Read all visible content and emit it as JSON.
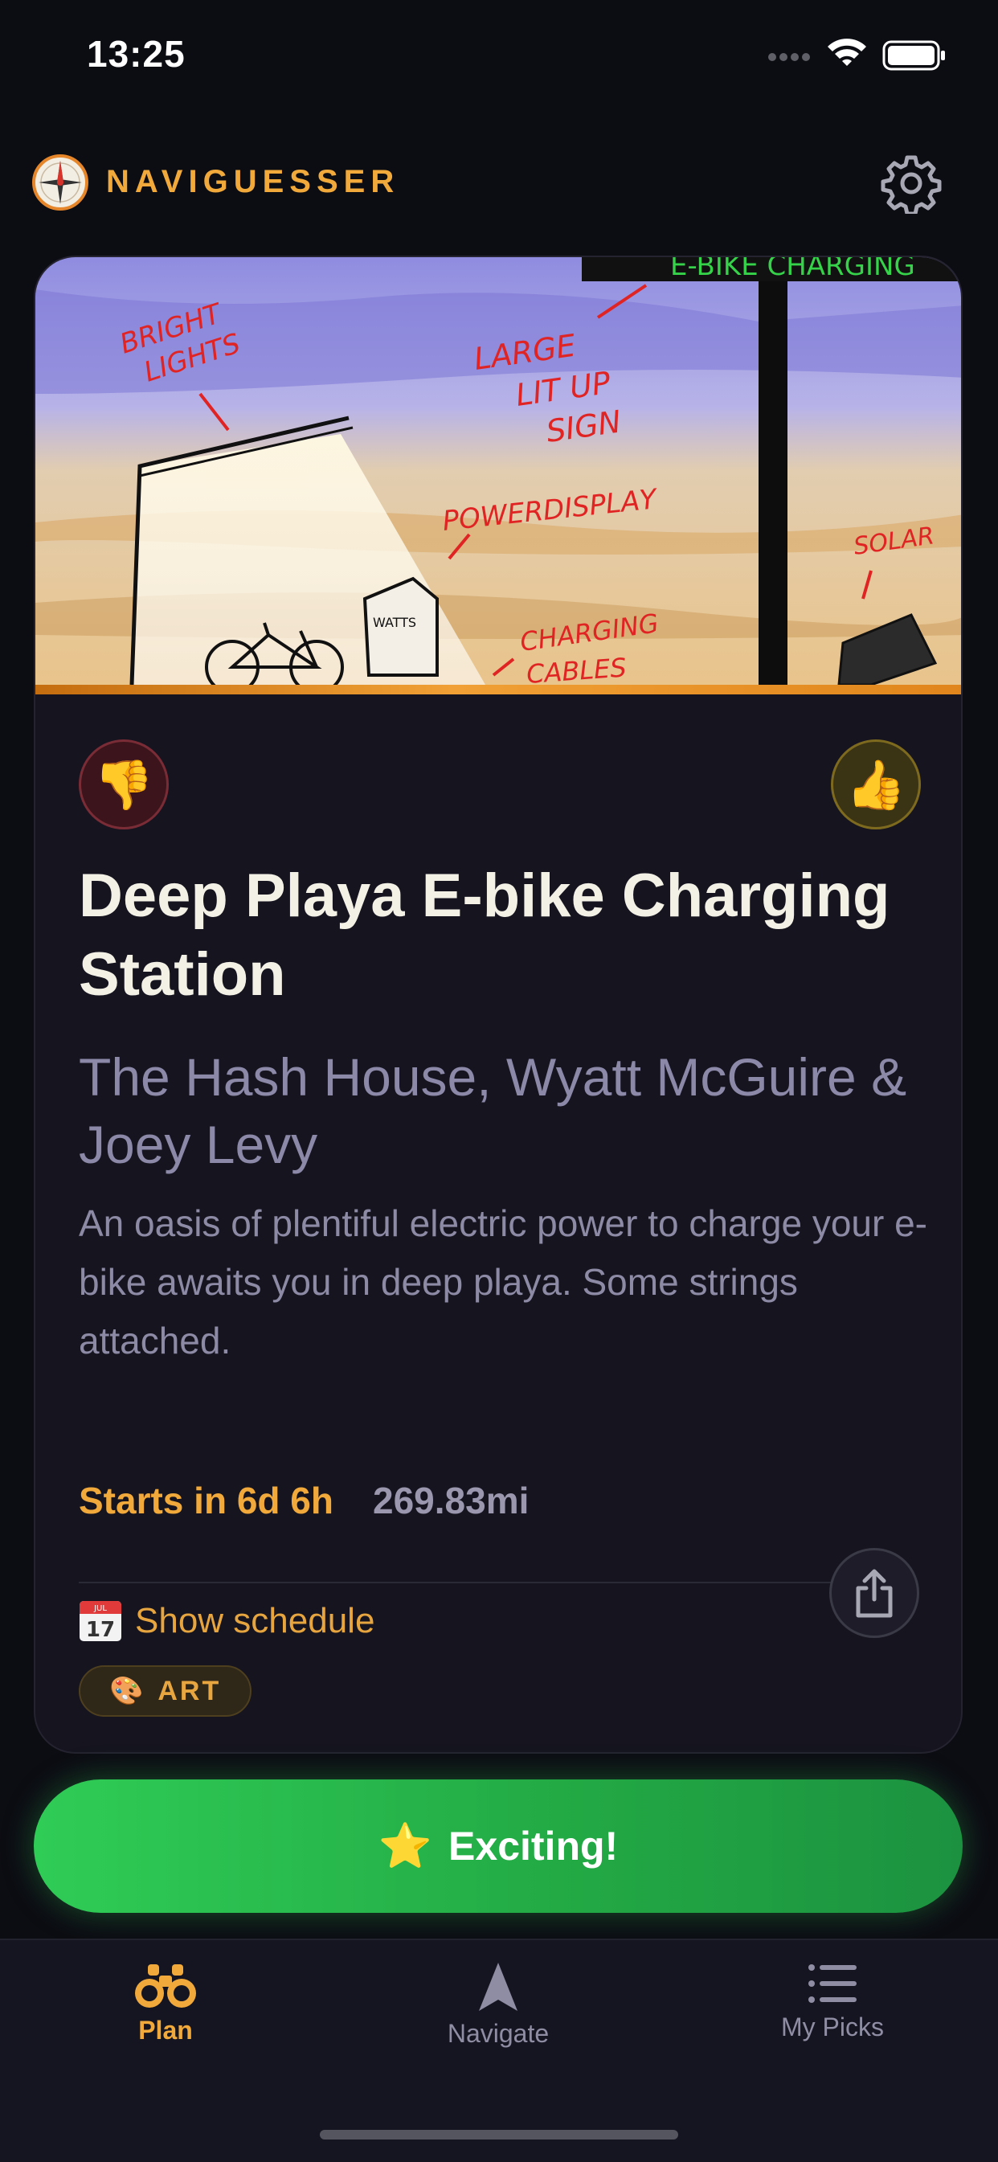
{
  "status_bar": {
    "time": "13:25"
  },
  "header": {
    "app_name": "NAVIGUESSER"
  },
  "card": {
    "title": "Deep Playa E-bike Charging Station",
    "hosts": "The Hash House, Wyatt McGuire & Joey Levy",
    "description": "An oasis of plentiful electric power to charge your e-bike awaits you in deep playa. Some strings attached.",
    "starts": "Starts in 6d 6h",
    "distance": "269.83mi",
    "schedule_label": "Show schedule",
    "calendar_day": "17",
    "calendar_month": "JUL",
    "tag": "ART",
    "dislike_icon": "👎",
    "like_icon": "👍",
    "tag_icon": "🎨",
    "artwork_labels": {
      "bright_lights": [
        "BRIGHT",
        "LIGHTS"
      ],
      "sign": [
        "LARGE",
        "LIT UP",
        "SIGN"
      ],
      "power": "POWERDISPLAY",
      "solar": "SOLAR",
      "charging": [
        "CHARGING",
        "CABLES"
      ],
      "watts": "WATTS",
      "banner": "E-BIKE CHARGING"
    }
  },
  "action_button": {
    "icon": "⭐",
    "label": "Exciting!"
  },
  "tabs": [
    {
      "label": "Plan",
      "icon": "binoculars-icon",
      "active": true
    },
    {
      "label": "Navigate",
      "icon": "navigation-arrow-icon",
      "active": false
    },
    {
      "label": "My Picks",
      "icon": "list-icon",
      "active": false
    }
  ],
  "colors": {
    "accent": "#f0a93a",
    "background": "#0c0c13",
    "card": "#15141f",
    "green": "#2fcc56",
    "muted": "#8b88a8"
  }
}
